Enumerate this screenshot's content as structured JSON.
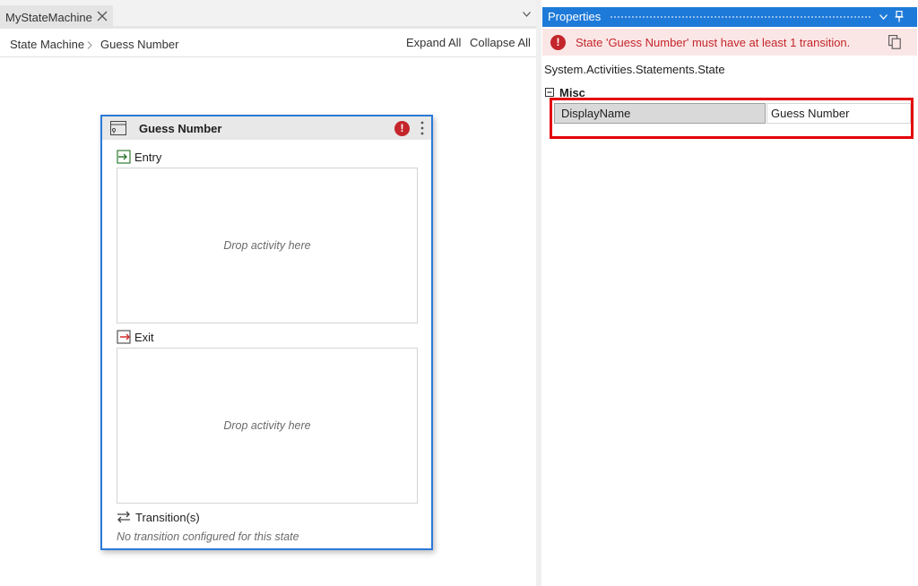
{
  "designer": {
    "tab_title": "MyStateMachine",
    "breadcrumb": [
      "State Machine",
      "Guess Number"
    ],
    "expand_all": "Expand All",
    "collapse_all": "Collapse All",
    "state": {
      "title": "Guess Number",
      "error_glyph": "!",
      "entry_label": "Entry",
      "entry_drop_text": "Drop activity here",
      "exit_label": "Exit",
      "exit_drop_text": "Drop activity here",
      "transitions_label": "Transition(s)",
      "no_transition_text": "No transition configured for this state"
    }
  },
  "properties": {
    "title": "Properties",
    "error_glyph": "!",
    "error_message": "State 'Guess Number' must have at least 1 transition.",
    "type_name": "System.Activities.Statements.State",
    "category": "Misc",
    "rows": [
      {
        "name": "DisplayName",
        "value": "Guess Number"
      }
    ]
  },
  "colors": {
    "accent": "#1e7ad8",
    "selection_border": "#2b79d8",
    "error": "#c4262b",
    "error_background": "#fbe6e6",
    "highlight": "#e3000b"
  },
  "icons": {
    "tab_close": "close-icon",
    "tab_dropdown": "chevron-down-icon",
    "breadcrumb_separator": "chevron-right-icon",
    "state": "state-icon",
    "entry": "entry-arrow-icon",
    "exit": "exit-arrow-icon",
    "transitions": "transition-arrows-icon",
    "copy": "copy-icon",
    "pin": "pin-icon"
  }
}
